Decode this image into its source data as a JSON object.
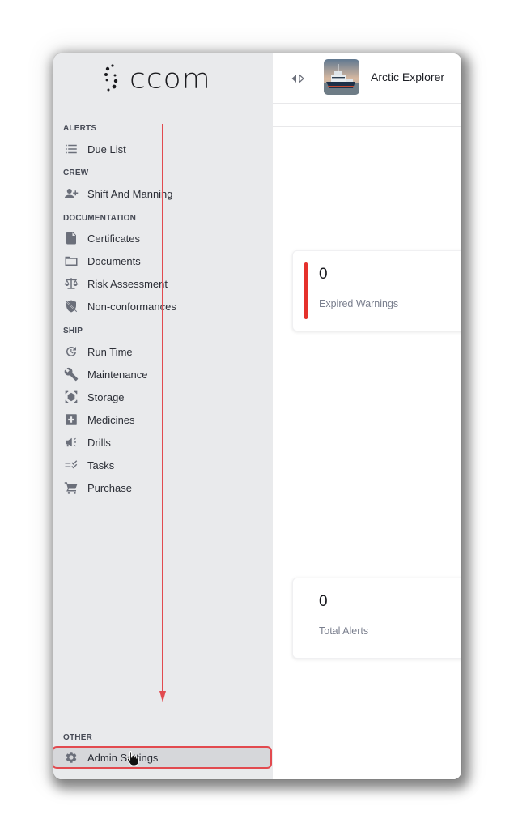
{
  "app": {
    "logo_text": "ccom"
  },
  "header": {
    "vessel_name": "Arctic Explorer",
    "vessel_image": "ship-photo"
  },
  "sidebar": {
    "sections": [
      {
        "label": "ALERTS",
        "items": [
          {
            "label": "Due List",
            "icon": "list-icon"
          }
        ]
      },
      {
        "label": "CREW",
        "items": [
          {
            "label": "Shift And Manning",
            "icon": "person-add-icon"
          }
        ]
      },
      {
        "label": "DOCUMENTATION",
        "items": [
          {
            "label": "Certificates",
            "icon": "file-icon"
          },
          {
            "label": "Documents",
            "icon": "folder-icon"
          },
          {
            "label": "Risk Assessment",
            "icon": "scale-icon"
          },
          {
            "label": "Non-conformances",
            "icon": "shield-off-icon"
          }
        ]
      },
      {
        "label": "SHIP",
        "items": [
          {
            "label": "Run Time",
            "icon": "history-icon"
          },
          {
            "label": "Maintenance",
            "icon": "wrench-icon"
          },
          {
            "label": "Storage",
            "icon": "box-scan-icon"
          },
          {
            "label": "Medicines",
            "icon": "medical-plus-icon"
          },
          {
            "label": "Drills",
            "icon": "megaphone-icon"
          },
          {
            "label": "Tasks",
            "icon": "checklist-icon"
          },
          {
            "label": "Purchase",
            "icon": "cart-icon"
          }
        ]
      },
      {
        "label": "OTHER",
        "items": [
          {
            "label": "Admin Settings",
            "icon": "gear-icon",
            "active": true
          }
        ]
      }
    ]
  },
  "cards": [
    {
      "value": "0",
      "label": "Expired Warnings",
      "accent": "#e5312c"
    },
    {
      "value": "0",
      "label": "Total Alerts"
    }
  ],
  "colors": {
    "sidebar_bg": "#e9eaec",
    "highlight_border": "#e24a4f",
    "annotation": "#e24a4f"
  }
}
